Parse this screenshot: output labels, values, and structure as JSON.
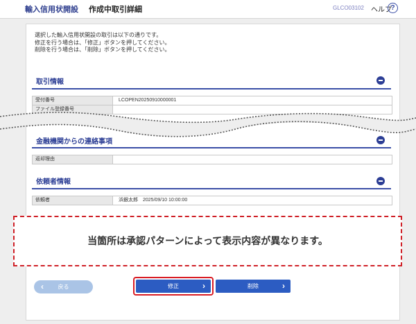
{
  "header": {
    "app_title": "輸入信用状開設",
    "page_title": "作成中取引詳細",
    "screen_code": "GLCO03102",
    "help_label": "ヘルプ",
    "help_icon": "?"
  },
  "intro": {
    "line1": "選択した輸入信用状開設の取引は以下の通りです。",
    "line2": "修正を行う場合は、「修正」ボタンを押してください。",
    "line3": "削除を行う場合は、「削除」ボタンを押してください。"
  },
  "sections": {
    "transaction": {
      "title": "取引情報",
      "rows": [
        {
          "label": "受付番号",
          "value": "LCOPEN20250910000001"
        },
        {
          "label": "ファイル登録番号",
          "value": ""
        }
      ]
    },
    "bank_contact": {
      "title": "金融機関からの連絡事項",
      "rows": [
        {
          "label": "返却理由",
          "value": ""
        }
      ]
    },
    "requester": {
      "title": "依頼者情報",
      "rows": [
        {
          "label": "依頼者",
          "value": "浜銀太郎　2025/09/10 10:00:00"
        }
      ]
    }
  },
  "notice": "当箇所は承認パターンによって表示内容が異なります。",
  "buttons": {
    "back": "戻る",
    "edit": "修正",
    "delete": "削除"
  },
  "colors": {
    "brand": "#2c3e95",
    "button": "#2c5cc2",
    "highlight": "#d91c24"
  }
}
